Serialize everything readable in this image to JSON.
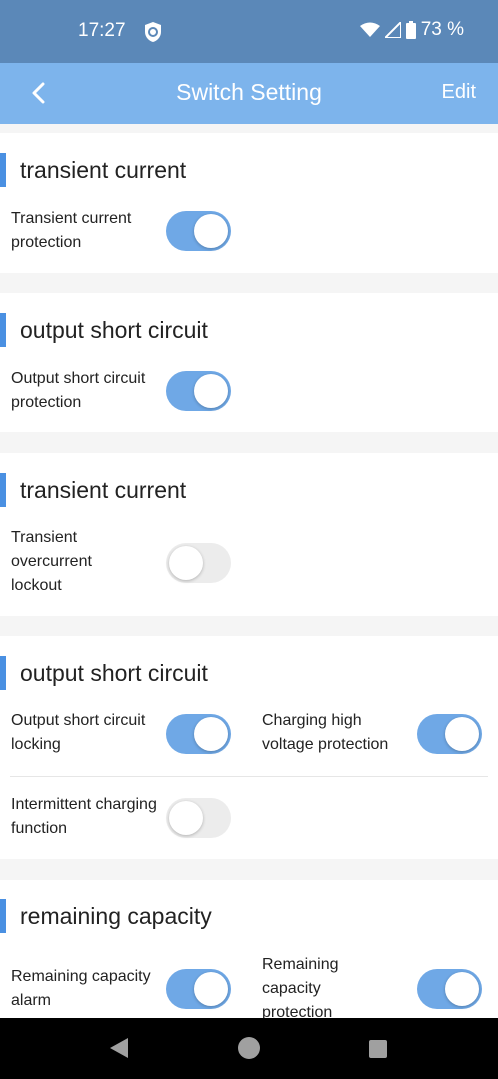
{
  "status_bar": {
    "time": "17:27",
    "battery": "73 %"
  },
  "app_bar": {
    "title": "Switch Setting",
    "edit_label": "Edit"
  },
  "sections": [
    {
      "title": "transient current",
      "items": [
        {
          "label": "Transient current protection",
          "on": true
        }
      ]
    },
    {
      "title": "output short circuit",
      "items": [
        {
          "label": "Output short circuit protection",
          "on": true
        }
      ]
    },
    {
      "title": "transient current",
      "items": [
        {
          "label": "Transient overcurrent lockout",
          "on": false
        }
      ]
    },
    {
      "title": "output short circuit",
      "items": [
        {
          "label": "Output short circuit locking",
          "on": true
        },
        {
          "label": "Charging high voltage protection",
          "on": true
        },
        {
          "label": "Intermittent charging function",
          "on": false
        }
      ]
    },
    {
      "title": "remaining capacity",
      "items": [
        {
          "label": "Remaining capacity alarm",
          "on": true
        },
        {
          "label": "Remaining capacity protection",
          "on": true
        }
      ]
    }
  ],
  "colors": {
    "status_bar": "#5b88b8",
    "app_bar": "#7db4ec",
    "accent": "#4a90e2",
    "toggle_on": "#6fa8e6",
    "toggle_off": "#ececec"
  },
  "icons": [
    "shield-icon",
    "wifi-icon",
    "signal-icon",
    "battery-icon",
    "back-arrow-icon",
    "nav-back-icon",
    "nav-home-icon",
    "nav-recents-icon"
  ]
}
